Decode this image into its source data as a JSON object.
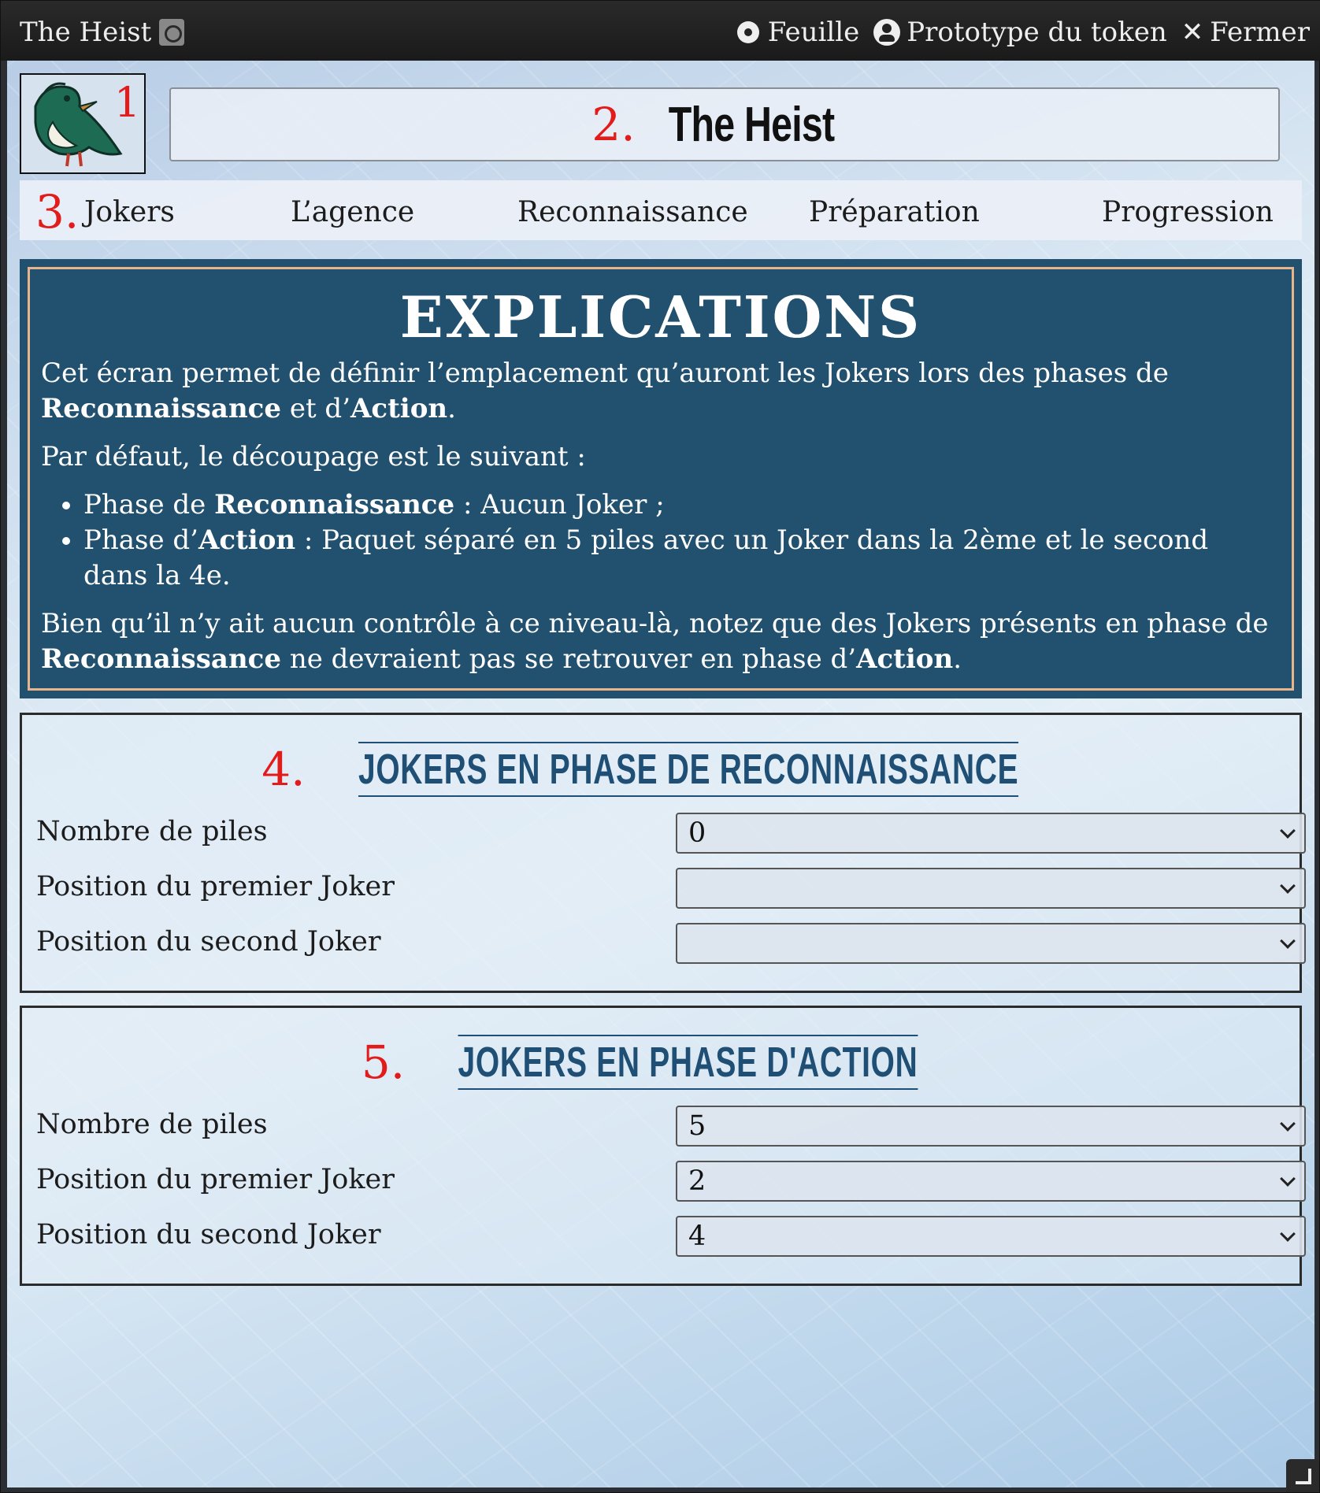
{
  "window": {
    "title": "The Heist",
    "controls": {
      "sheet_label": "Feuille",
      "token_label": "Prototype du token",
      "close_label": "Fermer"
    }
  },
  "annotations": {
    "a1": "1.",
    "a2": "2.",
    "a3": "3.",
    "a4": "4.",
    "a5": "5."
  },
  "sheet": {
    "name": "The Heist"
  },
  "tabs": [
    {
      "label": "Jokers"
    },
    {
      "label": "L’agence"
    },
    {
      "label": "Reconnaissance"
    },
    {
      "label": "Préparation"
    },
    {
      "label": "Progression"
    }
  ],
  "explain": {
    "title": "EXPLICATIONS",
    "p1_a": "Cet écran permet de définir l’emplacement qu’auront les Jokers lors des phases de ",
    "p1_b": "Reconnaissance",
    "p1_c": " et d’",
    "p1_d": "Action",
    "p1_e": ".",
    "p2": "Par défaut, le découpage est le suivant :",
    "li1_a": "Phase de ",
    "li1_b": "Reconnaissance",
    "li1_c": " : Aucun Joker ;",
    "li2_a": "Phase d’",
    "li2_b": "Action",
    "li2_c": " : Paquet séparé en 5 piles avec un Joker dans la 2ème et le second dans la 4e.",
    "p3_a": "Bien qu’il n’y ait aucun contrôle à ce niveau-là, notez que des Jokers présents en phase de ",
    "p3_b": "Reconnaissance",
    "p3_c": " ne devraient pas se retrouver en phase d’",
    "p3_d": "Action",
    "p3_e": "."
  },
  "recon": {
    "title": "JOKERS EN PHASE DE RECONNAISSANCE",
    "rows": [
      {
        "label": "Nombre de piles",
        "value": "0"
      },
      {
        "label": "Position du premier Joker",
        "value": ""
      },
      {
        "label": "Position du second Joker",
        "value": ""
      }
    ]
  },
  "action": {
    "title": "JOKERS EN PHASE D'ACTION",
    "rows": [
      {
        "label": "Nombre de piles",
        "value": "5"
      },
      {
        "label": "Position du premier Joker",
        "value": "2"
      },
      {
        "label": "Position du second Joker",
        "value": "4"
      }
    ]
  },
  "colors": {
    "accent_red": "#e21b1b",
    "panel_blue": "#22506f",
    "title_blue": "#1f4f74",
    "panel_border": "#e8b48c"
  }
}
